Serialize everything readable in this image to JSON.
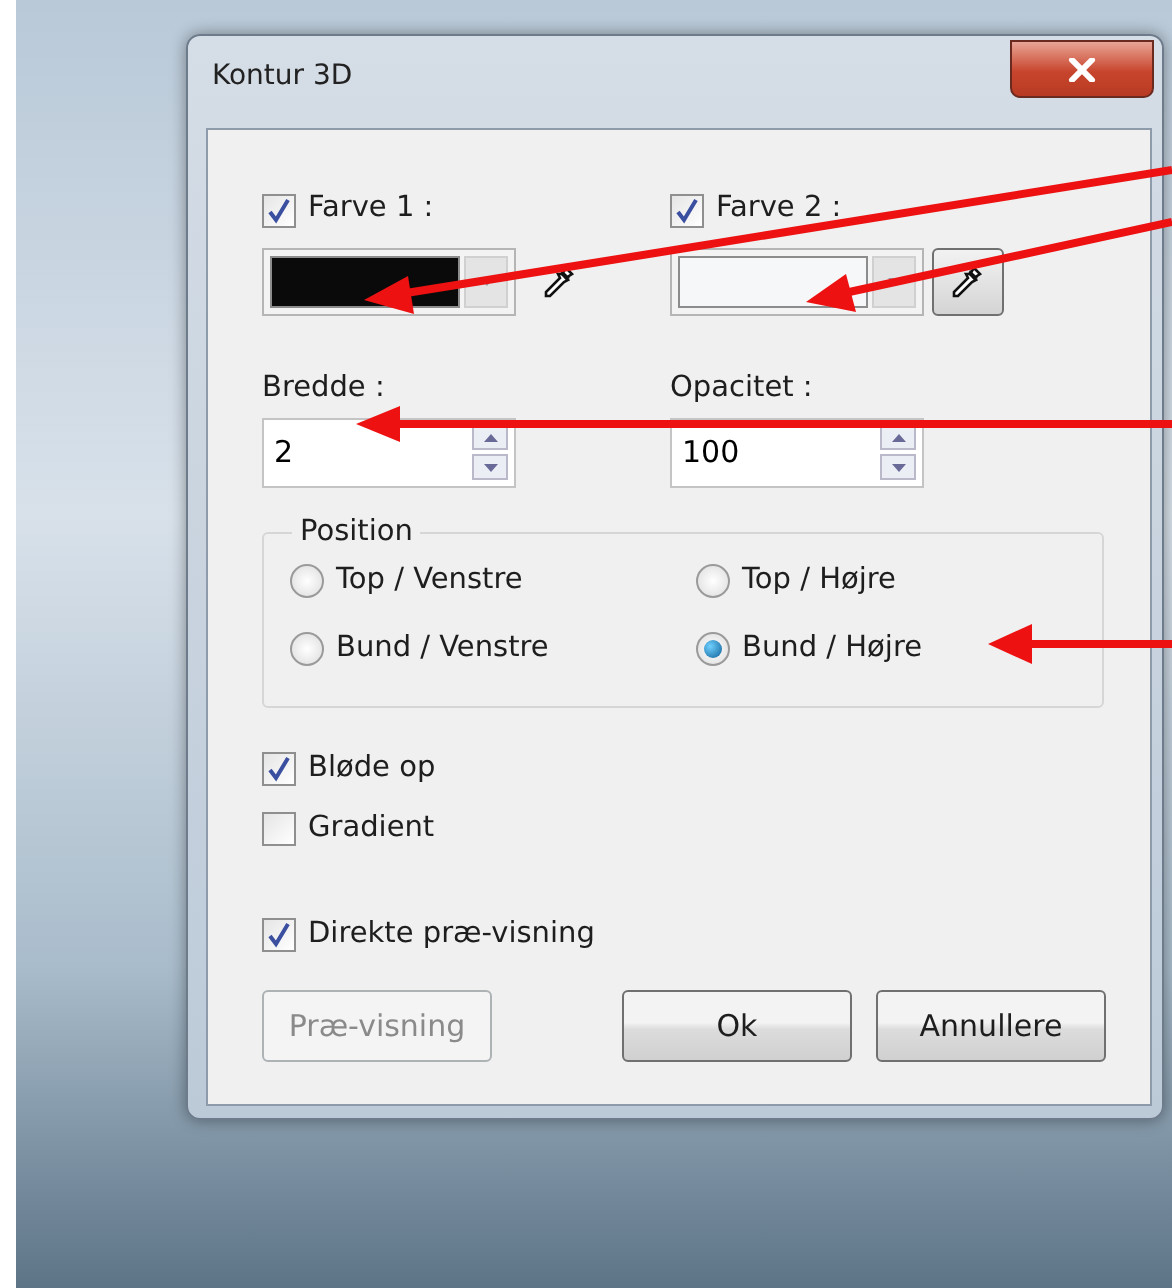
{
  "window": {
    "title": "Kontur 3D"
  },
  "colors": [
    {
      "label": "Farve 1 :",
      "checked": true,
      "color": "#0a0a0a",
      "picker_pressed": false
    },
    {
      "label": "Farve 2 :",
      "checked": true,
      "color": "#f6f7f9",
      "picker_pressed": true
    }
  ],
  "fields": [
    {
      "label": "Bredde :",
      "value": "2"
    },
    {
      "label": "Opacitet :",
      "value": "100"
    }
  ],
  "position": {
    "legend": "Position",
    "options": [
      {
        "label": "Top / Venstre",
        "selected": false
      },
      {
        "label": "Top / Højre",
        "selected": false
      },
      {
        "label": "Bund / Venstre",
        "selected": false
      },
      {
        "label": "Bund / Højre",
        "selected": true
      }
    ]
  },
  "options": [
    {
      "label": "Bløde op",
      "checked": true
    },
    {
      "label": "Gradient",
      "checked": false
    }
  ],
  "live_preview": {
    "label": "Direkte præ-visning",
    "checked": true
  },
  "buttons": [
    {
      "label": "Præ-visning",
      "disabled": true
    },
    {
      "label": "Ok",
      "disabled": false
    },
    {
      "label": "Annullere",
      "disabled": false
    }
  ]
}
